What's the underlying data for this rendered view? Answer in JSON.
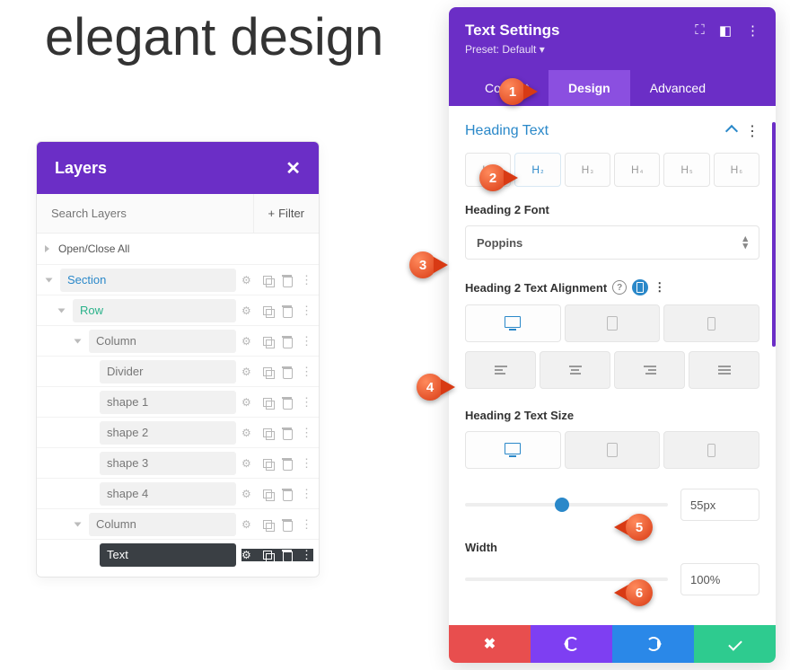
{
  "headline": "elegant design",
  "layers": {
    "title": "Layers",
    "search_placeholder": "Search Layers",
    "filter": "Filter",
    "open_close": "Open/Close All",
    "items": [
      {
        "label": "Section",
        "indent": 0,
        "variant": "blue",
        "arrow": "down"
      },
      {
        "label": "Row",
        "indent": 1,
        "variant": "green",
        "arrow": "down"
      },
      {
        "label": "Column",
        "indent": 2,
        "variant": "plain",
        "arrow": "down"
      },
      {
        "label": "Divider",
        "indent": 3,
        "variant": "plain"
      },
      {
        "label": "shape 1",
        "indent": 3,
        "variant": "plain"
      },
      {
        "label": "shape 2",
        "indent": 3,
        "variant": "plain"
      },
      {
        "label": "shape 3",
        "indent": 3,
        "variant": "plain"
      },
      {
        "label": "shape 4",
        "indent": 3,
        "variant": "plain"
      },
      {
        "label": "Column",
        "indent": 2,
        "variant": "plain",
        "arrow": "down"
      },
      {
        "label": "Text",
        "indent": 3,
        "variant": "dark"
      }
    ]
  },
  "settings": {
    "title": "Text Settings",
    "preset": "Preset: Default",
    "tabs": {
      "content": "Content",
      "design": "Design",
      "advanced": "Advanced",
      "active": "Design"
    },
    "section": "Heading Text",
    "h_levels": [
      "H₁",
      "H₂",
      "H₃",
      "H₄",
      "H₅",
      "H₆"
    ],
    "h_active": 1,
    "font_label": "Heading 2 Font",
    "font_value": "Poppins",
    "align_label": "Heading 2 Text Alignment",
    "size_label": "Heading 2 Text Size",
    "size_value": "55px",
    "size_percent": 48,
    "width_label": "Width",
    "width_value": "100%",
    "width_percent": 74
  },
  "markers": [
    "1",
    "2",
    "3",
    "4",
    "5",
    "6"
  ]
}
